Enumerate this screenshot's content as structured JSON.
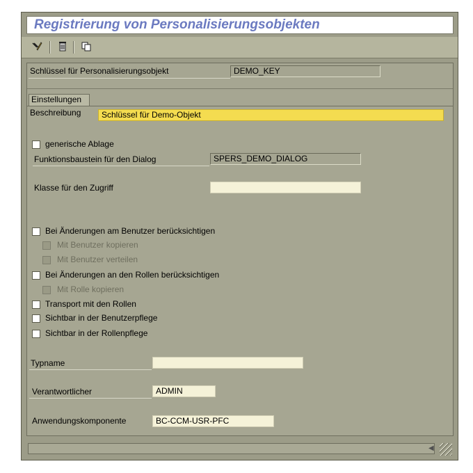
{
  "window": {
    "title": "Registrierung von Personalisierungsobjekten"
  },
  "toolbar": {
    "buttons": [
      "edit-icon",
      "delete-icon",
      "copy-icon"
    ]
  },
  "key": {
    "label": "Schlüssel für Personalisierungsobjekt",
    "value": "DEMO_KEY"
  },
  "tab": {
    "label": "Einstellungen"
  },
  "beschreibung": {
    "label": "Beschreibung",
    "value": "Schlüssel für Demo-Objekt"
  },
  "generische_ablage": {
    "label": "generische Ablage",
    "checked": false
  },
  "funktionsbaustein": {
    "label": "Funktionsbaustein für den Dialog",
    "value": "SPERS_DEMO_DIALOG"
  },
  "klasse": {
    "label": "Klasse für den Zugriff",
    "value": ""
  },
  "options": {
    "bei_aend_benutzer": "Bei Änderungen am Benutzer berücksichtigen",
    "mit_benutzer_kopieren": "Mit Benutzer kopieren",
    "mit_benutzer_verteilen": "Mit Benutzer verteilen",
    "bei_aend_rollen": "Bei Änderungen an den Rollen berücksichtigen",
    "mit_rolle_kopieren": "Mit Rolle kopieren",
    "transport_rollen": "Transport mit den Rollen",
    "sichtbar_benutzerpflege": "Sichtbar in der Benutzerpflege",
    "sichtbar_rollenpflege": "Sichtbar in der Rollenpflege"
  },
  "typname": {
    "label": "Typname",
    "value": ""
  },
  "verantwortlicher": {
    "label": "Verantwortlicher",
    "value": "ADMIN"
  },
  "anwendungskomponente": {
    "label": "Anwendungskomponente",
    "value": "BC-CCM-USR-PFC"
  },
  "colors": {
    "title": "#6b7ac0",
    "required_field": "#f4dc50",
    "input_field": "#f5f2d8",
    "background": "#a6a692"
  }
}
